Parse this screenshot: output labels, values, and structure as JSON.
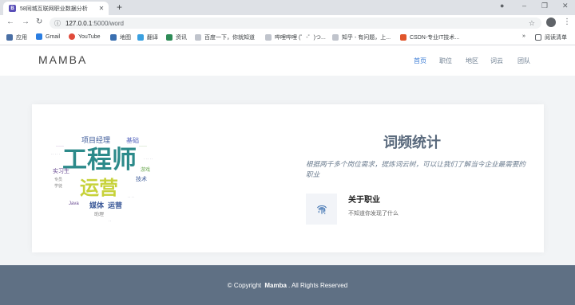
{
  "browser": {
    "tab_title": "58同城互联网职业数据分析",
    "tab_favicon": "B",
    "url_host": "127.0.0.1",
    "url_path": ":5000/word",
    "bookmarks": [
      "应用",
      "Gmail",
      "YouTube",
      "地图",
      "翻译",
      "资讯",
      "百度一下，你就知道",
      "哔哩哔哩 (゜-゜)つ...",
      "知乎 - 有问题，上...",
      "CSDN-专业IT技术..."
    ],
    "reading_list": "阅读清单",
    "more": "»"
  },
  "header": {
    "logo": "MAMBA",
    "nav": [
      "首页",
      "职位",
      "地区",
      "词云",
      "团队"
    ]
  },
  "wordcloud": {
    "words": [
      "工程师",
      "运营",
      "项目经理",
      "基础",
      "实习生",
      "媒体",
      "运营",
      "助理",
      "Java",
      "技术",
      "专员",
      "学徒",
      "游戏"
    ]
  },
  "section": {
    "title": "词频统计",
    "description": "根据两千多个岗位需求，提炼词云树，可以让我们了解当今企业最需要的职业",
    "feature_title": "关于职业",
    "feature_desc": "不知道你发现了什么"
  },
  "footer": {
    "prefix": "© Copyright",
    "brand": "Mamba",
    "suffix": ". All Rights Reserved"
  },
  "colors": {
    "footer_bg": "#5f7084",
    "accent": "#3a7bd5",
    "title": "#5a6a7d"
  }
}
